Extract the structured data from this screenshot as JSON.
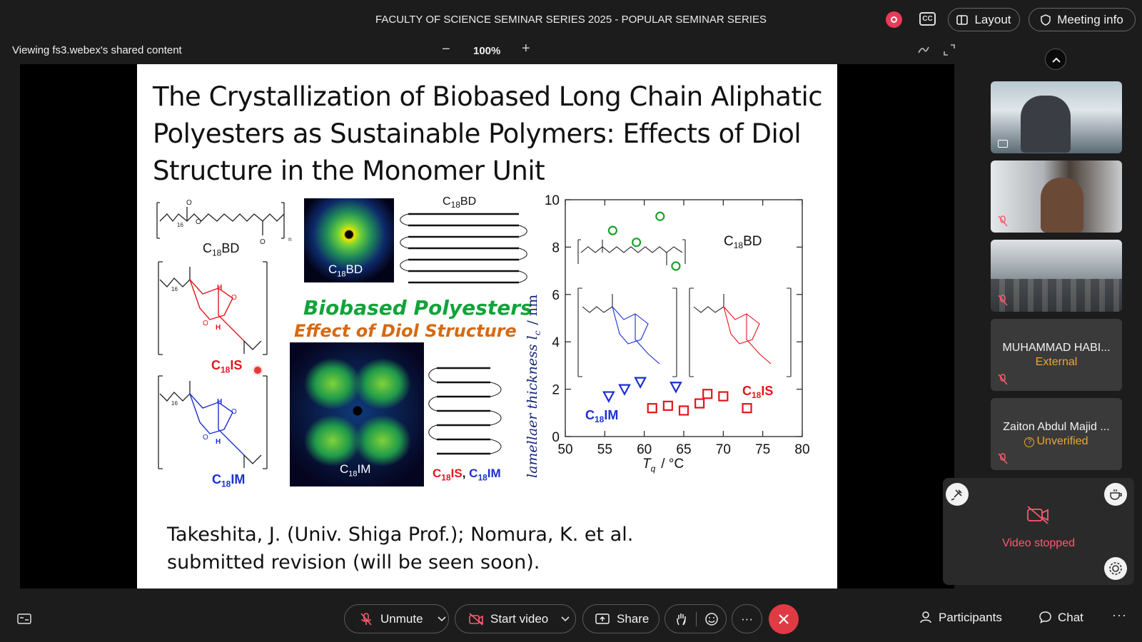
{
  "meeting": {
    "title": "FACULTY OF SCIENCE SEMINAR SERIES 2025 - POPULAR SEMINAR SERIES",
    "layout_label": "Layout",
    "meeting_info_label": "Meeting info",
    "cc_label": "CC"
  },
  "share_bar": {
    "viewing_label": "Viewing fs3.webex's shared content",
    "zoom_minus": "−",
    "zoom": "100%",
    "zoom_plus": "+"
  },
  "slide": {
    "title": "The Crystallization of Biobased Long Chain Aliphatic Polyesters as Sustainable Polymers: Effects of Diol Structure in the Monomer Unit",
    "compounds": {
      "c18bd_base": "C",
      "c18bd_sub": "18",
      "c18bd_suffix": "BD",
      "c18is_suffix": "IS",
      "c18im_suffix": "IM"
    },
    "biobased_heading": "Biobased Polyesters",
    "biobased_subheading": "Effect of Diol Structure",
    "combined_label_sep": ", ",
    "credit_line1": "Takeshita, J. (Univ. Shiga Prof.); Nomura, K. et al.",
    "credit_line2": "submitted revision (will be seen soon)."
  },
  "chart_data": {
    "type": "scatter",
    "xlabel": "T",
    "xlabel_sub": "q",
    "xlabel_unit": "/ °C",
    "ylabel": "lamellaer thickness l",
    "ylabel_sub": "c",
    "ylabel_unit": "/ nm",
    "xlim": [
      50,
      80
    ],
    "ylim": [
      0,
      10
    ],
    "xticks": [
      50,
      55,
      60,
      65,
      70,
      75,
      80
    ],
    "yticks": [
      0,
      2,
      4,
      6,
      8,
      10
    ],
    "series": [
      {
        "name": "C18BD",
        "color": "#1fa12b",
        "marker": "circle",
        "points": [
          [
            56,
            8.7
          ],
          [
            59,
            8.2
          ],
          [
            62,
            9.3
          ],
          [
            64,
            7.2
          ]
        ]
      },
      {
        "name": "C18IM",
        "color": "#1a2fd0",
        "marker": "triangle",
        "points": [
          [
            55.5,
            1.7
          ],
          [
            57.5,
            2.0
          ],
          [
            59.5,
            2.3
          ],
          [
            64,
            2.1
          ]
        ]
      },
      {
        "name": "C18IS",
        "color": "#e3161b",
        "marker": "square",
        "points": [
          [
            61,
            1.2
          ],
          [
            63,
            1.3
          ],
          [
            65,
            1.1
          ],
          [
            67,
            1.4
          ],
          [
            68,
            1.8
          ],
          [
            70,
            1.7
          ],
          [
            73,
            1.2
          ]
        ]
      }
    ]
  },
  "participants": [
    {
      "name": "MUHAMMAD HABI...",
      "status": "External"
    },
    {
      "name": "Zaiton Abdul Majid ...",
      "status": "Unverified"
    }
  ],
  "self_view": {
    "status": "Video stopped"
  },
  "controls": {
    "unmute": "Unmute",
    "start_video": "Start video",
    "share": "Share",
    "more": "···",
    "participants": "Participants",
    "chat": "Chat",
    "overflow": "···"
  },
  "colors": {
    "accent_red": "#e03b44",
    "recording": "#e83b57",
    "external": "#f0a632",
    "video_stopped": "#ff5a6e"
  }
}
